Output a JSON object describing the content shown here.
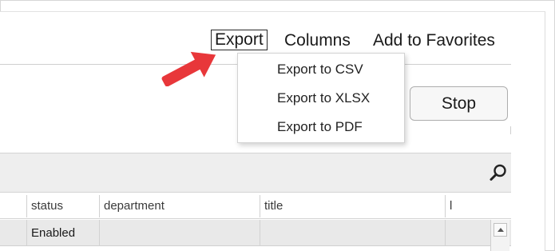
{
  "toolbar": {
    "export_label": "Export",
    "columns_label": "Columns",
    "favorites_label": "Add to Favorites"
  },
  "export_menu": {
    "items": [
      {
        "label": "Export to CSV"
      },
      {
        "label": "Export to XLSX"
      },
      {
        "label": "Export to PDF"
      }
    ]
  },
  "actions": {
    "stop_label": "Stop"
  },
  "grid": {
    "columns": [
      "status",
      "department",
      "title",
      "l"
    ],
    "rows": [
      {
        "status": "Enabled",
        "department": "",
        "title": "",
        "extra": ""
      }
    ]
  },
  "icons": {
    "search": "search-icon",
    "arrow": "pointer-arrow-icon",
    "scroll_up": "scroll-up-icon"
  },
  "colors": {
    "arrow": "#e8373a",
    "search_strip": "#eeeeee",
    "selected_row": "#e9e9e9"
  }
}
